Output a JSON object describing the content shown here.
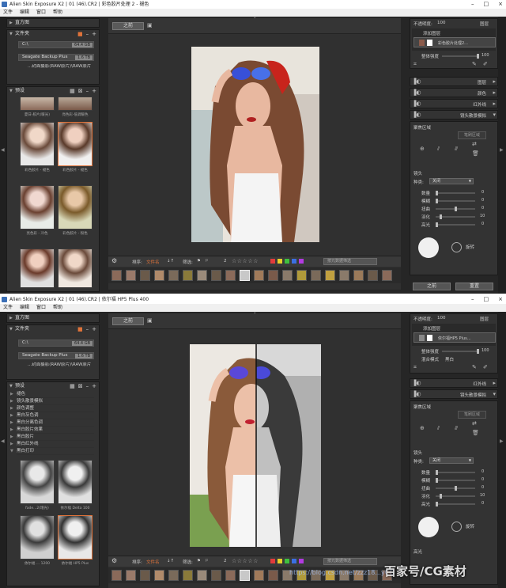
{
  "s1": {
    "title": "Alien Skin Exposure X2 | 01 (46).CR2 | 彩色胶片处理 2 - 褪色",
    "menu": [
      "文件",
      "编辑",
      "窗口",
      "帮助"
    ],
    "nav_panel": "直方图",
    "folders_panel": "文件夹",
    "drive_c": {
      "name": "C:\\",
      "size": "64.4 GB"
    },
    "drive_ext": {
      "name": "Seagate Backup Plus",
      "size": "1.6 TB"
    },
    "folder_item": "...封面摄影(RAW原片)\\RAW原片",
    "presets_panel": "预设",
    "thumb_labels": [
      "夏日-胶片(暖光)",
      "亮色彩-低调暖色",
      "彩色胶片 - 褪色",
      "彩色胶片 - 褪色",
      "亮色彩 - 冷色",
      "彩色胶片 - 粉色",
      "彩色胶片 - ...",
      "彩色胶片 - ..."
    ],
    "before_btn": "之前",
    "sort_label": "排序:",
    "sort_value": "文件名",
    "filter_label": "筛选:",
    "search_placeholder": "按元数据筛选",
    "stars": "☆☆☆☆☆",
    "count": "2",
    "opacity_label": "不透明度:",
    "opacity_value": "100",
    "layer_label": "图层",
    "add_layer": "添加图层",
    "layer_name": "彩色胶片处理2...",
    "strength_label": "整体强度",
    "strength_value": "100",
    "panels": [
      "图层",
      "颜色",
      "红外线",
      "镜头散景模拟"
    ],
    "bokeh_area": "聚焦区域",
    "brush_btn": "笔刷区域",
    "lens_label": "镜头",
    "type_label": "种类:",
    "type_value": "关闭",
    "lens_rows": [
      {
        "name": "数量",
        "value": "0"
      },
      {
        "name": "模糊",
        "value": "0"
      },
      {
        "name": "扭曲",
        "value": "0"
      },
      {
        "name": "羽化",
        "value": "10"
      },
      {
        "name": "高光",
        "value": "0"
      }
    ],
    "rotate_label": "旋转",
    "prev_btn": "之前",
    "reset_btn": "重置"
  },
  "s2": {
    "title": "Alien Skin Exposure X2 | 01 (46).CR2 | 依尔福 HP5 Plus 400",
    "menu": [
      "文件",
      "编辑",
      "窗口",
      "帮助"
    ],
    "nav_panel": "直方图",
    "folders_panel": "文件夹",
    "drive_c": {
      "name": "C:\\",
      "size": "64.4 GB"
    },
    "drive_ext": {
      "name": "Seagate Backup Plus",
      "size": "1.6 TB"
    },
    "folder_item": "...封面摄影(RAW原片)\\RAW原片",
    "presets_panel": "预设",
    "preset_items": [
      "褪色",
      "镜头散景模拟",
      "颜色调整",
      "黑白灰色调",
      "黑白分离色调",
      "黑白胶片效果",
      "黑白胶片",
      "黑白红外线",
      "黑白打印"
    ],
    "thumb_labels": [
      "fade...2(增光)",
      "依尔福 Delta 100",
      "依尔福 ... 1200",
      "依尔福 HP5 Plus"
    ],
    "before_btn": "之前",
    "sort_label": "排序:",
    "sort_value": "文件名",
    "filter_label": "筛选:",
    "search_placeholder": "按元数据筛选",
    "stars": "☆☆☆☆☆",
    "count": "2",
    "opacity_label": "不透明度:",
    "opacity_value": "100",
    "layer_label": "图层",
    "add_layer": "添加图层",
    "layer_name": "依尔福HP5 Plus...",
    "strength_label": "整体强度",
    "strength_value": "100",
    "blend_label": "混合模式",
    "blend_value": "黑白",
    "panels": [
      "红外线",
      "镜头散景模拟"
    ],
    "bokeh_area": "聚焦区域",
    "brush_btn": "笔刷区域",
    "lens_label": "镜头",
    "type_label": "种类:",
    "type_value": "关闭",
    "lens_rows": [
      {
        "name": "数量",
        "value": "0"
      },
      {
        "name": "模糊",
        "value": "0"
      },
      {
        "name": "扭曲",
        "value": "0"
      },
      {
        "name": "羽化",
        "value": "10"
      },
      {
        "name": "高光",
        "value": "0"
      }
    ],
    "rotate_label": "旋转",
    "highlight_label": "高光",
    "watermark": "百家号/CG素材",
    "watermark_url": "https://blog.csdn.net/zzz18...yCG"
  },
  "colors": {
    "accent": "#e0733a",
    "swatches": [
      "#e23b3b",
      "#e8d02a",
      "#3fbf3f",
      "#3b6fe2",
      "#b33be2"
    ]
  }
}
